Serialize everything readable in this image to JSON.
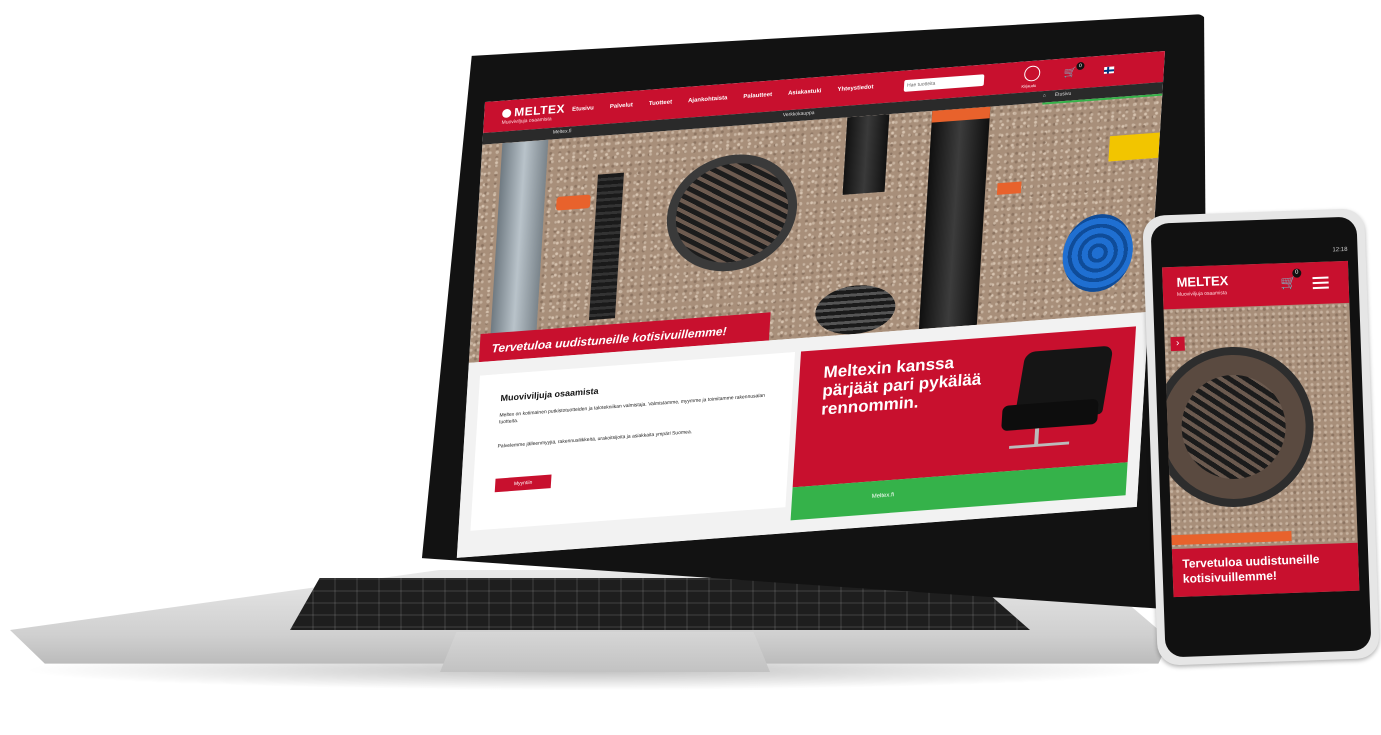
{
  "brand": {
    "name": "MELTEX",
    "tagline": "Muoviviljuja osaamista",
    "colors": {
      "primary": "#c8102e",
      "secondary": "#35b24a",
      "dark": "#111111"
    }
  },
  "laptop_site": {
    "nav": [
      "Etusivu",
      "Palvelut",
      "Tuotteet",
      "Ajankohtaista",
      "Palautteet",
      "Asiakastuki",
      "Yhteystiedot"
    ],
    "search_placeholder": "Hae tuotteita",
    "user_label": "Kirjaudu",
    "cart_count": "0",
    "subbar": {
      "left": "Meltex.fi",
      "center": "Verkkokauppa",
      "right": "Etusivu"
    },
    "hero_title": "Tervetuloa uudistuneille kotisivuillemme!",
    "intro": {
      "title": "Muoviviljuja osaamista",
      "p1": "Meltex on kotimainen putkistotuotteiden ja talotekniikan valmistaja. Valmistamme, myymme ja toimitamme rakennusalan tuotteita.",
      "p2": "Palvelemme jälleenmyyjiä, rakennusliikkeitä, urakoitsijoita ja asiakkaita ympäri Suomea.",
      "button": "Myyntiin"
    },
    "promo": {
      "headline": "Meltexin kanssa pärjäät pari pykälää rennommin.",
      "bar_text": "Meltex.fi"
    }
  },
  "phone_site": {
    "status": "12:18",
    "cart_count": "0",
    "arrow": "›",
    "hero_title": "Tervetuloa uudistuneille kotisivuillemme!"
  },
  "icons": [
    "home-icon",
    "user-icon",
    "cart-icon",
    "flag-icon",
    "menu-icon",
    "arrow-right-icon"
  ]
}
